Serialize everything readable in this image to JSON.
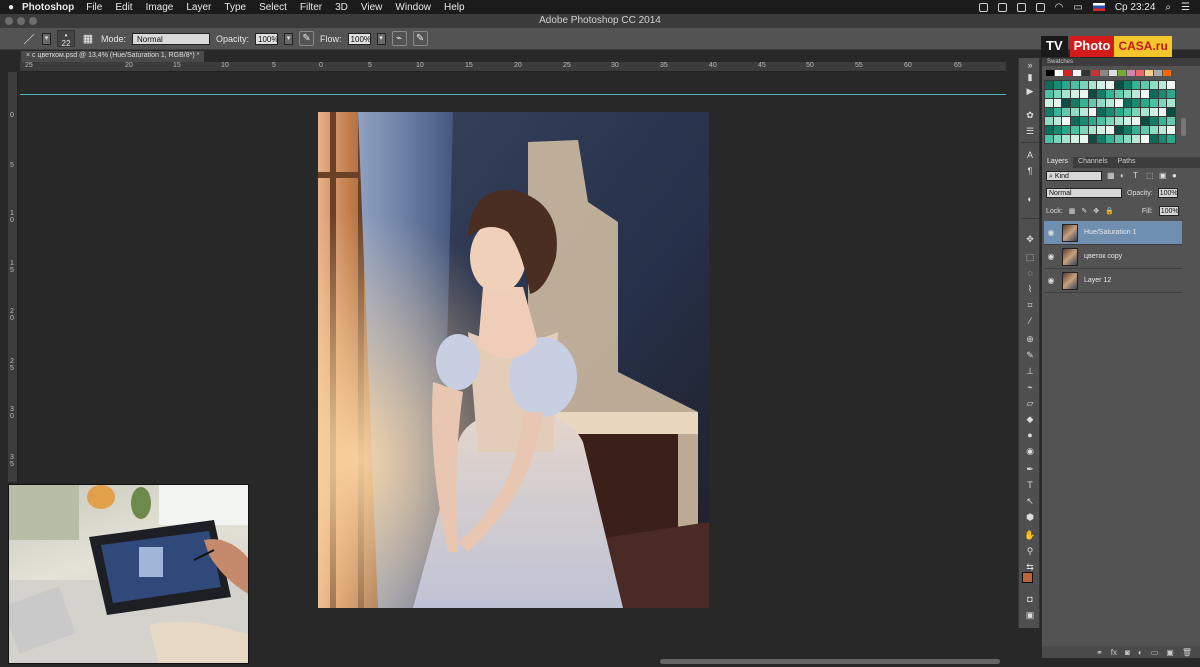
{
  "menubar": {
    "apple": "",
    "app_name": "Photoshop",
    "items": [
      "File",
      "Edit",
      "Image",
      "Layer",
      "Type",
      "Select",
      "Filter",
      "3D",
      "View",
      "Window",
      "Help"
    ],
    "clock": "Ср 23:24",
    "search_icon": "search-icon"
  },
  "window": {
    "title": "Adobe Photoshop CC 2014"
  },
  "options": {
    "brush_size": "22",
    "mode_label": "Mode:",
    "mode_value": "Normal",
    "opacity_label": "Opacity:",
    "opacity_value": "100%",
    "flow_label": "Flow:",
    "flow_value": "100%"
  },
  "document": {
    "tab_label": "с цветком.psd @ 13,4% (Hue/Saturation 1, RGB/8*) *"
  },
  "ruler": {
    "h_ticks": [
      "25",
      "20",
      "15",
      "10",
      "5",
      "0",
      "5",
      "10",
      "15",
      "20",
      "25",
      "30",
      "35",
      "40",
      "45",
      "50",
      "55",
      "60",
      "65"
    ],
    "v_ticks": [
      "0",
      "5",
      "1\n0",
      "1\n5",
      "2\n0",
      "2\n5",
      "3\n0",
      "3\n5",
      "4\n0"
    ]
  },
  "logo": {
    "tv": "TV",
    "photo": "Photo",
    "casa": "CASA.ru"
  },
  "swatches": {
    "title": "Swatches"
  },
  "layers_panel": {
    "tabs": [
      "Layers",
      "Channels",
      "Paths"
    ],
    "kind_label": "Kind",
    "blend_mode": "Normal",
    "opacity_label": "Opacity:",
    "opacity_value": "100%",
    "lock_label": "Lock:",
    "fill_label": "Fill:",
    "fill_value": "100%",
    "layers": [
      {
        "name": "Hue/Saturation 1",
        "selected": true
      },
      {
        "name": "цветок copy",
        "selected": false
      },
      {
        "name": "Layer 12",
        "selected": false
      }
    ]
  },
  "colors": {
    "foreground": "#b9643a",
    "background": "#cfcfcf",
    "guide": "#4fb4c4",
    "selection": "#6f8fb0"
  }
}
